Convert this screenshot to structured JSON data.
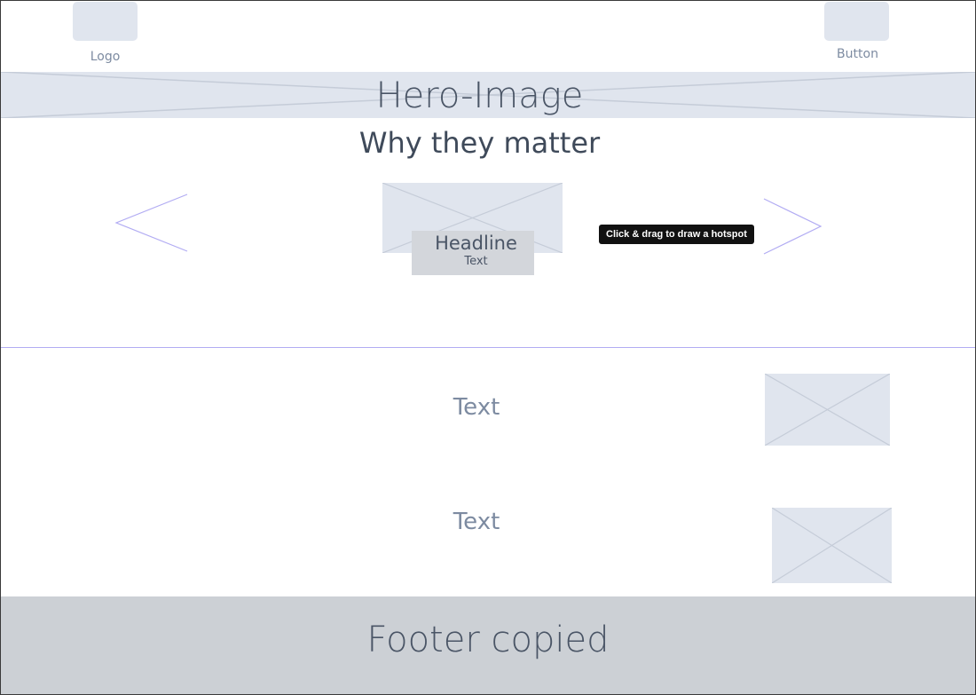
{
  "header": {
    "logo_label": "Logo",
    "button_label": "Button"
  },
  "hero": {
    "title": "Hero-Image"
  },
  "section": {
    "title": "Why they matter"
  },
  "carousel": {
    "card_headline": "Headline",
    "card_text": "Text",
    "prev_icon": "chevron-left-icon",
    "next_icon": "chevron-right-icon"
  },
  "tooltip": {
    "text": "Click & drag to draw a hotspot"
  },
  "features": [
    {
      "text": "Text"
    },
    {
      "text": "Text"
    }
  ],
  "footer": {
    "text": "Footer copied"
  },
  "colors": {
    "placeholder_fill": "#e0e5ee",
    "placeholder_lines": "#c5ccd8",
    "hotspot_outline": "#b2acf3",
    "footer_background": "#ccd0d5",
    "tooltip_background": "#111111"
  }
}
